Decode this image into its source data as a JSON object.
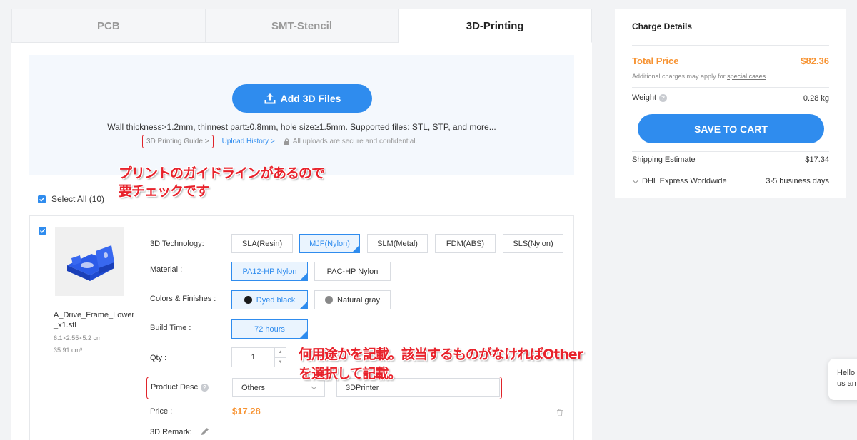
{
  "tabs": [
    {
      "label": "PCB",
      "active": false
    },
    {
      "label": "SMT-Stencil",
      "active": false
    },
    {
      "label": "3D-Printing",
      "active": true
    }
  ],
  "upload": {
    "button_label": "Add 3D Files",
    "hint": "Wall thickness>1.2mm, thinnest part≥0.8mm, hole size≥1.5mm. Supported files: STL, STP, and more...",
    "guide_link": "3D Printing Guide >",
    "history_link": "Upload History >",
    "secure_text": "All uploads are secure and confidential."
  },
  "annotations": {
    "guide_note_line1": "プリントのガイドラインがあるので",
    "guide_note_line2": "要チェックです",
    "desc_note": "何用途かを記載。該当するものがなければOtherを選択して記載。"
  },
  "select_all": "Select All (10)",
  "item": {
    "file_name": "A_Drive_Frame_Lower_x1.stl",
    "dimensions": "6.1×2.55×5.2 cm",
    "volume": "35.91 cm³",
    "technology_label": "3D Technology:",
    "technologies": [
      "SLA(Resin)",
      "MJF(Nylon)",
      "SLM(Metal)",
      "FDM(ABS)",
      "SLS(Nylon)"
    ],
    "selected_technology": "MJF(Nylon)",
    "material_label": "Material :",
    "materials": [
      "PA12-HP Nylon",
      "PAC-HP Nylon"
    ],
    "colors_label": "Colors & Finishes :",
    "colors": [
      {
        "name": "Dyed black",
        "swatch": "#1a1a1a"
      },
      {
        "name": "Natural gray",
        "swatch": "#888888"
      }
    ],
    "build_time_label": "Build Time :",
    "build_time": "72 hours",
    "qty_label": "Qty :",
    "qty": "1",
    "product_desc_label": "Product Desc",
    "product_desc_select": "Others",
    "product_desc_input": "3DPrinter",
    "price_label": "Price :",
    "price": "$17.28",
    "remark_label": "3D Remark:"
  },
  "charge": {
    "title": "Charge Details",
    "total_label": "Total Price",
    "total_value": "$82.36",
    "additional_prefix": "Additional charges may apply for ",
    "additional_link": "special cases",
    "weight_label": "Weight",
    "weight_value": "0.28 kg",
    "cart_button": "SAVE TO CART",
    "shipping_label": "Shipping Estimate",
    "shipping_value": "$17.34",
    "carrier": "DHL Express Worldwide",
    "carrier_time": "3-5 business days"
  },
  "chat": {
    "line1": "Hello",
    "line2": "us an"
  },
  "colors": {
    "accent": "#2f8cee",
    "price": "#f79332",
    "annotation": "#e8222b"
  }
}
